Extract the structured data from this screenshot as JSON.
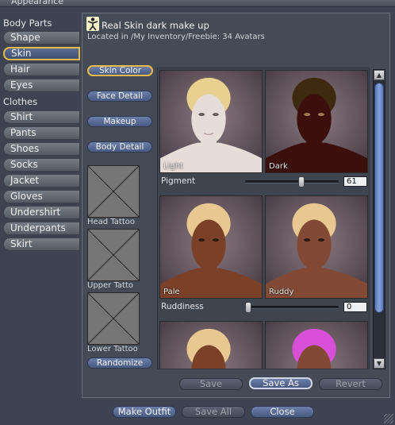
{
  "window": {
    "title": "Appearance"
  },
  "sidebar": {
    "body_parts_label": "Body Parts",
    "body_parts": [
      {
        "label": "Shape",
        "selected": false
      },
      {
        "label": "Skin",
        "selected": true
      },
      {
        "label": "Hair",
        "selected": false
      },
      {
        "label": "Eyes",
        "selected": false
      }
    ],
    "clothes_label": "Clothes",
    "clothes": [
      {
        "label": "Shirt"
      },
      {
        "label": "Pants"
      },
      {
        "label": "Shoes"
      },
      {
        "label": "Socks"
      },
      {
        "label": "Jacket"
      },
      {
        "label": "Gloves"
      },
      {
        "label": "Undershirt"
      },
      {
        "label": "Underpants"
      },
      {
        "label": "Skirt"
      }
    ]
  },
  "header": {
    "title": "Real Skin dark make up",
    "path": "Located in /My Inventory/Freebie: 34 Avatars",
    "icon": "figure-icon"
  },
  "subtabs": [
    {
      "label": "Skin Color",
      "selected": true
    },
    {
      "label": "Face Detail",
      "selected": false
    },
    {
      "label": "Makeup",
      "selected": false
    },
    {
      "label": "Body Detail",
      "selected": false
    }
  ],
  "tattoos": [
    {
      "label": "Head Tattoo"
    },
    {
      "label": "Upper Tatto"
    },
    {
      "label": "Lower Tattoo"
    }
  ],
  "randomize_label": "Randomize",
  "sliders": [
    {
      "label": "Pigment",
      "left_label": "Light",
      "right_label": "Dark",
      "value": "61",
      "fraction": 0.61
    },
    {
      "label": "Ruddiness",
      "left_label": "Pale",
      "right_label": "Ruddy",
      "value": "0",
      "fraction": 0.0
    }
  ],
  "actions": {
    "save": "Save",
    "save_as": "Save As",
    "revert": "Revert"
  },
  "footer": {
    "make_outfit": "Make Outfit",
    "save_all": "Save All",
    "close": "Close"
  },
  "colors": {
    "selected_border": "#e8b84a",
    "button_blue": "#5a6e92",
    "panel_bg": "#454b56",
    "window_bg": "#3d4350",
    "skin_light": "#e8dcd8",
    "skin_dark": "#3a0f0c",
    "skin_pale": "#7a4028",
    "skin_ruddy": "#824a34",
    "magenta_makeup": "#d84fd8"
  }
}
